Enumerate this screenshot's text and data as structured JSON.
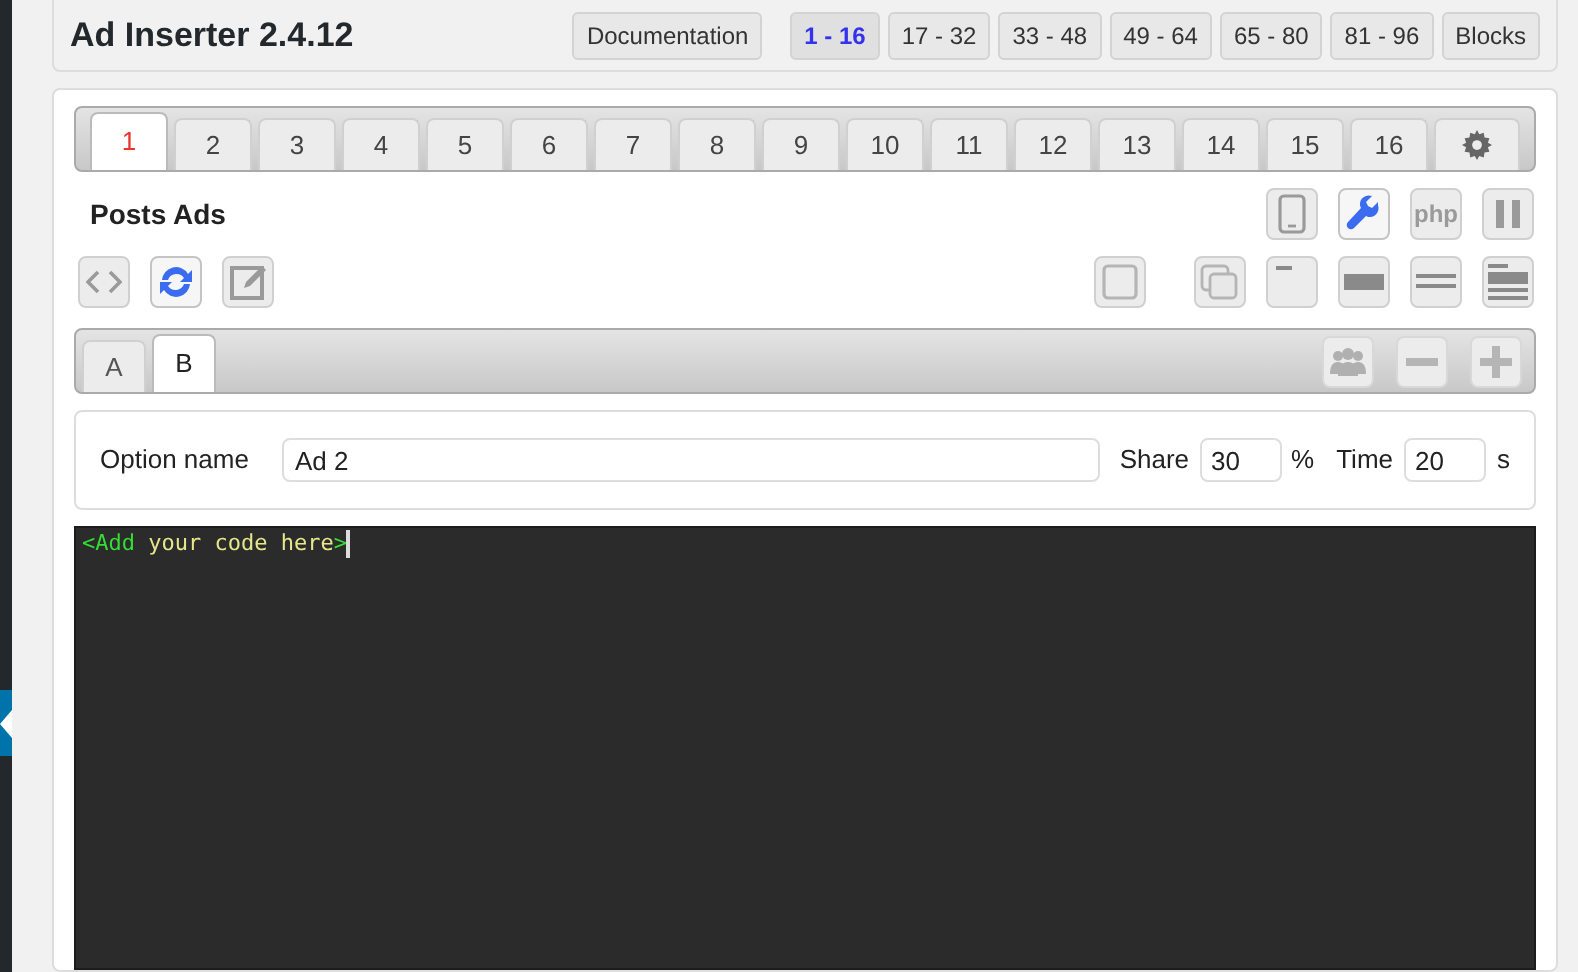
{
  "header": {
    "title": "Ad Inserter 2.4.12",
    "documentation": "Documentation",
    "ranges": [
      {
        "label": "1 - 16",
        "selected": true
      },
      {
        "label": "17 - 32",
        "selected": false
      },
      {
        "label": "33 - 48",
        "selected": false
      },
      {
        "label": "49 - 64",
        "selected": false
      },
      {
        "label": "65 - 80",
        "selected": false
      },
      {
        "label": "81 - 96",
        "selected": false
      }
    ],
    "blocks": "Blocks"
  },
  "block_tabs": [
    {
      "label": "1",
      "selected": true
    },
    {
      "label": "2",
      "selected": false
    },
    {
      "label": "3",
      "selected": false
    },
    {
      "label": "4",
      "selected": false
    },
    {
      "label": "5",
      "selected": false
    },
    {
      "label": "6",
      "selected": false
    },
    {
      "label": "7",
      "selected": false
    },
    {
      "label": "8",
      "selected": false
    },
    {
      "label": "9",
      "selected": false
    },
    {
      "label": "10",
      "selected": false
    },
    {
      "label": "11",
      "selected": false
    },
    {
      "label": "12",
      "selected": false
    },
    {
      "label": "13",
      "selected": false
    },
    {
      "label": "14",
      "selected": false
    },
    {
      "label": "15",
      "selected": false
    },
    {
      "label": "16",
      "selected": false
    }
  ],
  "block_name": "Posts Ads",
  "toolbar_top": [
    {
      "kind": "device",
      "on": false
    },
    {
      "kind": "wrench",
      "on": true
    },
    {
      "kind": "php",
      "label": "php",
      "on": false
    },
    {
      "kind": "pause",
      "on": false
    }
  ],
  "toolbar_left": [
    {
      "kind": "code",
      "on": false
    },
    {
      "kind": "sync",
      "on": true
    },
    {
      "kind": "edit",
      "on": false
    }
  ],
  "toolbar_right": [
    {
      "kind": "box",
      "on": false
    },
    {
      "kind": "overlap",
      "on": false
    },
    {
      "kind": "top",
      "on": false
    },
    {
      "kind": "bar",
      "on": false
    },
    {
      "kind": "bottom",
      "on": false
    },
    {
      "kind": "lines",
      "on": false
    }
  ],
  "option_tabs": [
    {
      "label": "A",
      "selected": false
    },
    {
      "label": "B",
      "selected": true
    }
  ],
  "option_tools": [
    {
      "kind": "group"
    },
    {
      "kind": "minus"
    },
    {
      "kind": "plus"
    }
  ],
  "option": {
    "name_label": "Option name",
    "name_value": "Ad 2",
    "share_label": "Share",
    "share_value": "30",
    "share_unit": "%",
    "time_label": "Time",
    "time_value": "20",
    "time_unit": "s"
  },
  "code": [
    {
      "kind": "tag",
      "text": "<Add"
    },
    {
      "kind": "text",
      "text": " your code here"
    },
    {
      "kind": "tag",
      "text": ">"
    }
  ]
}
